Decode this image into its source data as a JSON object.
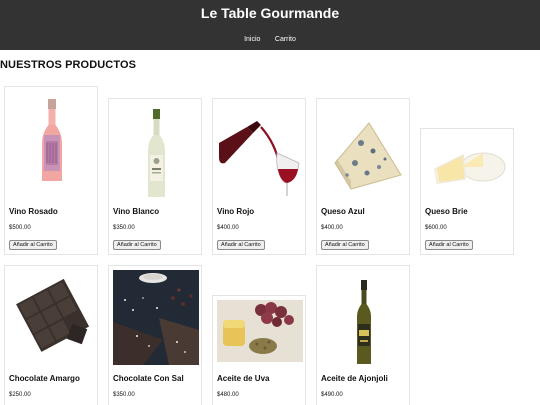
{
  "header": {
    "title": "Le Table Gourmande",
    "nav": [
      {
        "label": "Inicio"
      },
      {
        "label": "Carrito"
      }
    ]
  },
  "main": {
    "section_title": "NUESTROS PRODUCTOS",
    "add_label": "Añadir al Carrito",
    "products": [
      {
        "name": "Vino Rosado",
        "price": "$500.00"
      },
      {
        "name": "Vino Blanco",
        "price": "$350.00"
      },
      {
        "name": "Vino Rojo",
        "price": "$400.00"
      },
      {
        "name": "Queso Azul",
        "price": "$400.00"
      },
      {
        "name": "Queso Brie",
        "price": "$600.00"
      },
      {
        "name": "Chocolate Amargo",
        "price": "$250.00"
      },
      {
        "name": "Chocolate Con Sal",
        "price": "$350.00"
      },
      {
        "name": "Aceite de Uva",
        "price": "$480.00"
      },
      {
        "name": "Aceite de Ajonjoli",
        "price": "$490.00"
      }
    ]
  },
  "colors": {
    "header_bg": "#333333",
    "header_text": "#ffffff",
    "card_border": "#e4e4e4"
  }
}
